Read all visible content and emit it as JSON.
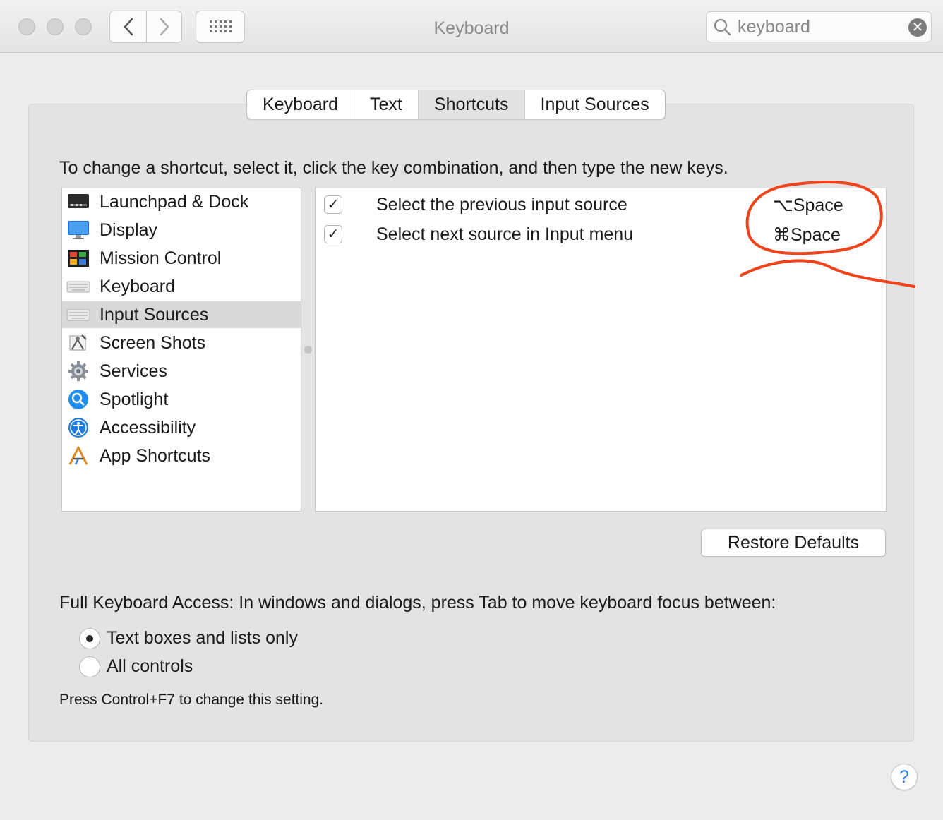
{
  "window": {
    "title": "Keyboard"
  },
  "search": {
    "value": "keyboard",
    "clear_icon": "close-circle-icon"
  },
  "tabs": [
    {
      "label": "Keyboard",
      "active": false
    },
    {
      "label": "Text",
      "active": false
    },
    {
      "label": "Shortcuts",
      "active": true
    },
    {
      "label": "Input Sources",
      "active": false
    }
  ],
  "instructions": "To change a shortcut, select it, click the key combination, and then type the new keys.",
  "categories": [
    {
      "label": "Launchpad & Dock",
      "icon": "launchpad-dock-icon"
    },
    {
      "label": "Display",
      "icon": "display-icon"
    },
    {
      "label": "Mission Control",
      "icon": "mission-control-icon"
    },
    {
      "label": "Keyboard",
      "icon": "keyboard-icon"
    },
    {
      "label": "Input Sources",
      "icon": "keyboard-icon",
      "selected": true
    },
    {
      "label": "Screen Shots",
      "icon": "screenshot-icon"
    },
    {
      "label": "Services",
      "icon": "gear-icon"
    },
    {
      "label": "Spotlight",
      "icon": "spotlight-icon"
    },
    {
      "label": "Accessibility",
      "icon": "accessibility-icon"
    },
    {
      "label": "App Shortcuts",
      "icon": "app-shortcuts-icon"
    }
  ],
  "shortcuts": [
    {
      "checked": true,
      "checkmark": "✓",
      "description": "Select the previous input source",
      "keys": "⌥Space"
    },
    {
      "checked": true,
      "checkmark": "✓",
      "description": "Select next source in Input menu",
      "keys": "⌘Space"
    }
  ],
  "restore_button": "Restore Defaults",
  "full_keyboard_access": {
    "label": "Full Keyboard Access: In windows and dialogs, press Tab to move keyboard focus between:",
    "options": [
      {
        "label": "Text boxes and lists only",
        "selected": true
      },
      {
        "label": "All controls",
        "selected": false
      }
    ],
    "hint": "Press Control+F7 to change this setting."
  },
  "help_button": "?",
  "colors": {
    "annotation": "#f0431c",
    "accent": "#2f7cf6"
  }
}
